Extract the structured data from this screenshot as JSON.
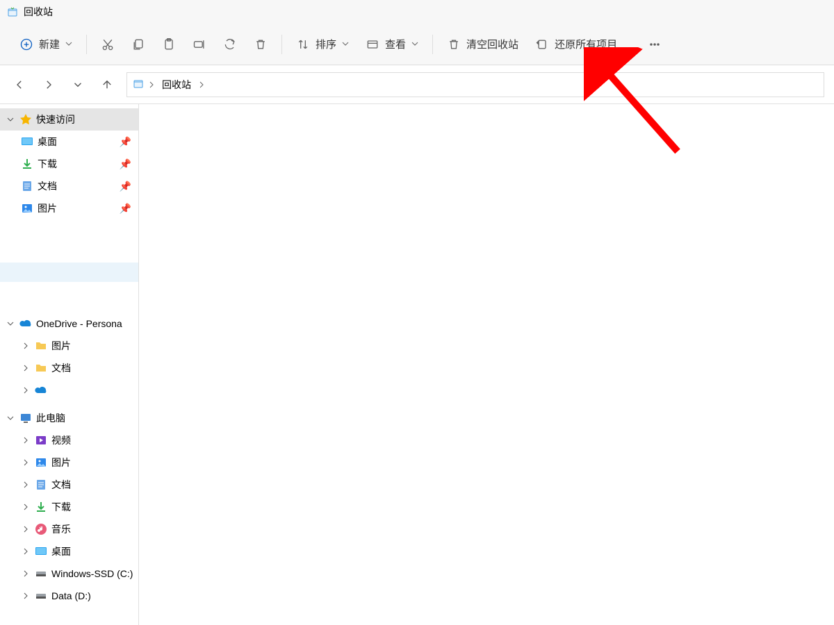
{
  "titlebar": {
    "title": "回收站"
  },
  "toolbar": {
    "new_label": "新建",
    "sort_label": "排序",
    "view_label": "查看",
    "empty_label": "清空回收站",
    "restore_all_label": "还原所有项目"
  },
  "breadcrumb": {
    "item": "回收站"
  },
  "sidebar": {
    "quick_access": {
      "label": "快速访问",
      "items": [
        {
          "label": "桌面"
        },
        {
          "label": "下载"
        },
        {
          "label": "文档"
        },
        {
          "label": "图片"
        }
      ]
    },
    "onedrive": {
      "label": "OneDrive - Persona",
      "items": [
        {
          "label": "图片"
        },
        {
          "label": "文档"
        }
      ]
    },
    "this_pc": {
      "label": "此电脑",
      "items": [
        {
          "label": "视频"
        },
        {
          "label": "图片"
        },
        {
          "label": "文档"
        },
        {
          "label": "下载"
        },
        {
          "label": "音乐"
        },
        {
          "label": "桌面"
        },
        {
          "label": "Windows-SSD (C:)"
        },
        {
          "label": "Data (D:)"
        }
      ]
    }
  }
}
